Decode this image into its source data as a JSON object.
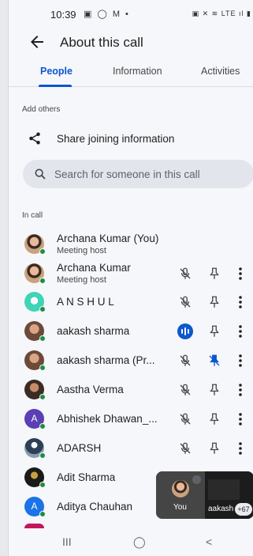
{
  "status": {
    "time": "10:39",
    "left_icons": "▣ ◯ M •",
    "right_icons": "▣ ✕ ≋ LTE ıl ▮"
  },
  "header": {
    "title": "About this call"
  },
  "tabs": [
    {
      "label": "People"
    },
    {
      "label": "Information"
    },
    {
      "label": "Activities"
    }
  ],
  "add_others": {
    "section_label": "Add others",
    "share_label": "Share joining information"
  },
  "search": {
    "placeholder": "Search for someone in this call"
  },
  "in_call": {
    "section_label": "In call",
    "participants": [
      {
        "name": "Archana Kumar (You)",
        "subtitle": "Meeting host"
      },
      {
        "name": "Archana Kumar",
        "subtitle": "Meeting host"
      },
      {
        "name": "A N S H U L"
      },
      {
        "name": "aakash sharma"
      },
      {
        "name": "aakash sharma (Pr..."
      },
      {
        "name": "Aastha Verma"
      },
      {
        "name": "Abhishek Dhawan_...",
        "initial": "A"
      },
      {
        "name": "ADARSH"
      },
      {
        "name": "Adit Sharma"
      },
      {
        "name": "Aditya Chauhan",
        "initial": "A"
      }
    ]
  },
  "preview": {
    "you_label": "You",
    "other_label": "aakash",
    "extra_count": "+67"
  },
  "nav": {
    "recents": "III",
    "home": "◯",
    "back": "<"
  },
  "colors": {
    "accent": "#0b57d0",
    "online": "#1e8e3e",
    "background": "#f6f7fa"
  }
}
